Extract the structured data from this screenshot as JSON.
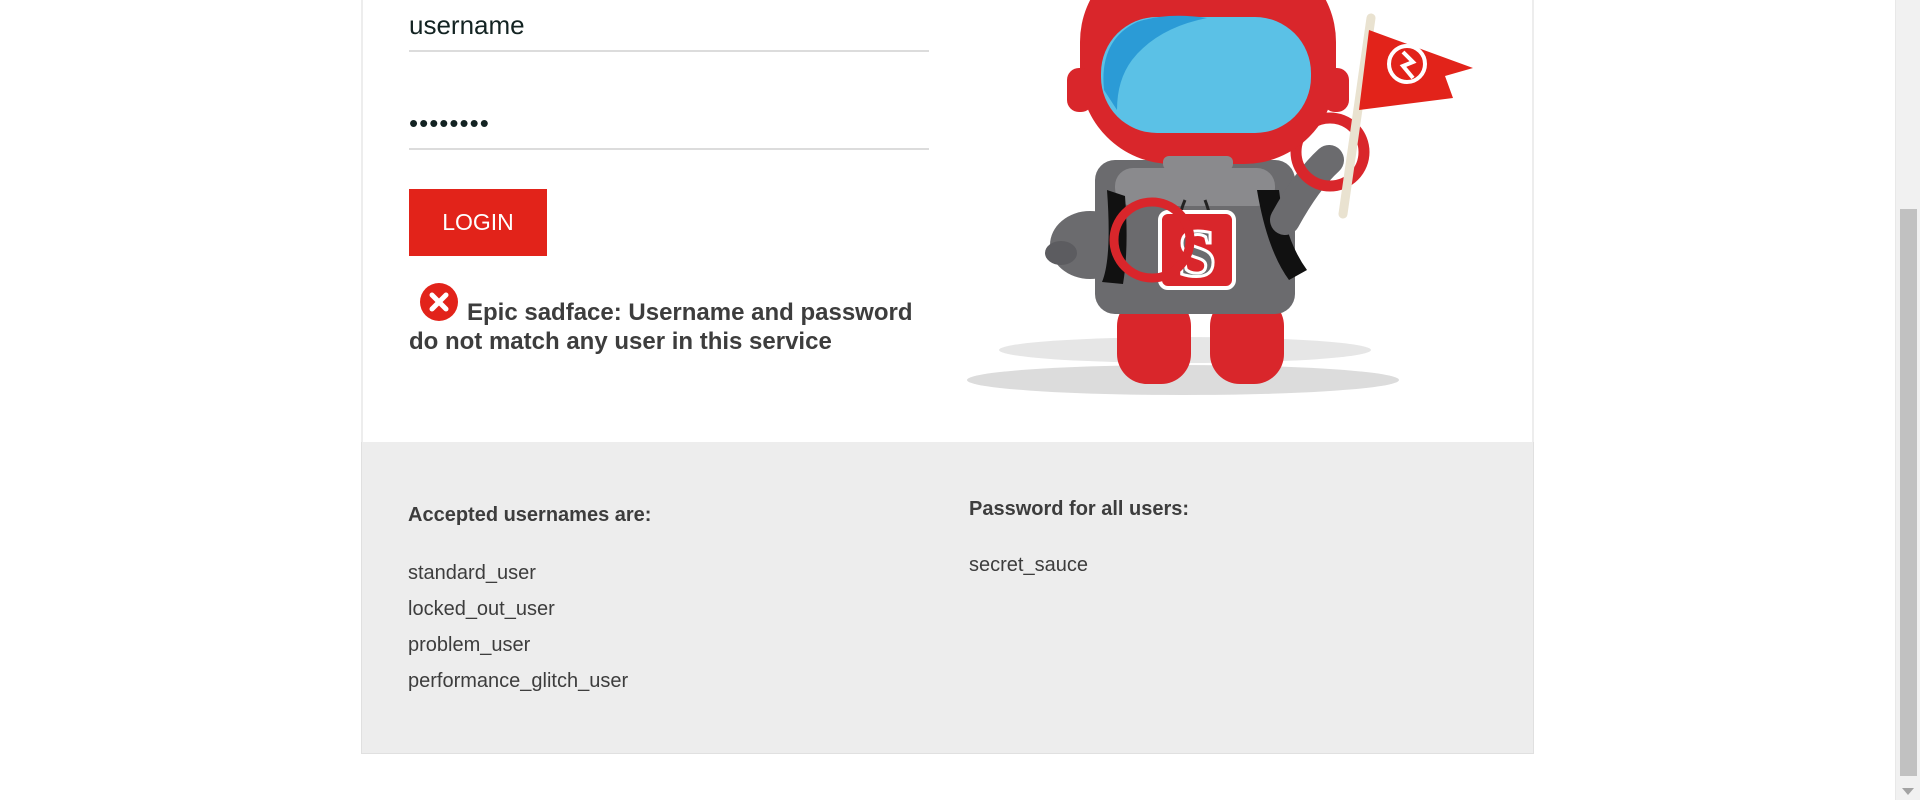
{
  "login": {
    "username_value": "username",
    "password_value": "••••••••",
    "login_button_label": "LOGIN",
    "error_message": "Epic sadface: Username and password do not match any user in this service",
    "error_icon": "circle-x-icon"
  },
  "mascot": {
    "icon": "swag-bot-mascot"
  },
  "credentials": {
    "usernames_heading": "Accepted usernames are:",
    "usernames": [
      "standard_user",
      "locked_out_user",
      "problem_user",
      "performance_glitch_user"
    ],
    "password_heading": "Password for all users:",
    "password": "secret_sauce"
  },
  "colors": {
    "accent": "#e2231a",
    "text": "#3d3d3d",
    "panel_bg": "#ededed"
  }
}
